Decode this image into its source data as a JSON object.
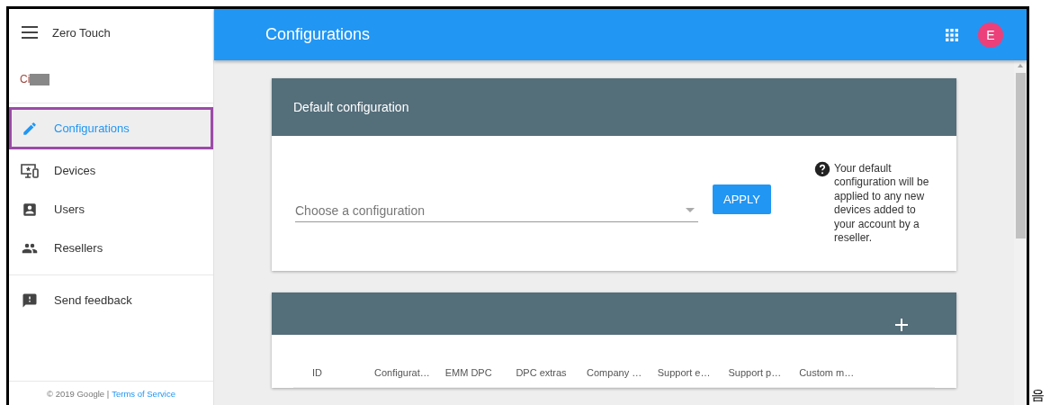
{
  "sidebar": {
    "title": "Zero Touch",
    "account": "Ci",
    "items": [
      {
        "label": "Configurations",
        "selected": true
      },
      {
        "label": "Devices",
        "selected": false
      },
      {
        "label": "Users",
        "selected": false
      },
      {
        "label": "Resellers",
        "selected": false
      }
    ],
    "feedback": {
      "label": "Send feedback"
    },
    "footer": {
      "copyright": "© 2019 Google |",
      "link": "Terms of Service"
    }
  },
  "header": {
    "title": "Configurations",
    "avatar": "E"
  },
  "default_configuration": {
    "title": "Default configuration",
    "select": {
      "placeholder": "Choose a configuration"
    },
    "button": "APPLY",
    "help": "Your default configuration will be applied to any new devices added to your account by a reseller."
  },
  "configurations_table": {
    "columns": [
      "ID",
      "Configurat…",
      "EMM DPC",
      "DPC extras",
      "Company …",
      "Support e…",
      "Support p…",
      "Custom m…"
    ]
  },
  "margin_text": "음"
}
